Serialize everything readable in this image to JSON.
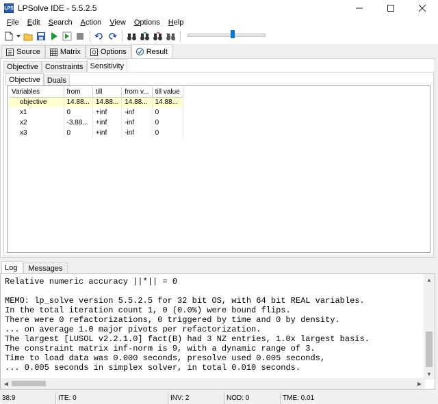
{
  "window": {
    "title": "LPSolve IDE - 5.5.2.5",
    "icon_text": "LPS"
  },
  "menu": [
    "File",
    "Edit",
    "Search",
    "Action",
    "View",
    "Options",
    "Help"
  ],
  "toolbar": {
    "slider_value": 0.58,
    "accent": "#0078d7"
  },
  "main_tabs": [
    {
      "label": "Source",
      "icon": "source-icon"
    },
    {
      "label": "Matrix",
      "icon": "matrix-icon"
    },
    {
      "label": "Options",
      "icon": "options-icon"
    },
    {
      "label": "Result",
      "icon": "result-icon",
      "active": true
    }
  ],
  "result_tabs": [
    "Objective",
    "Constraints",
    "Sensitivity"
  ],
  "sensitivity_tabs": [
    "Objective",
    "Duals"
  ],
  "grid": {
    "headers": [
      "Variables",
      "from",
      "till",
      "from v...",
      "till value"
    ],
    "rows": [
      [
        "objective",
        "14.88...",
        "14.88...",
        "14.88...",
        "14.88..."
      ],
      [
        "x1",
        "0",
        "+inf",
        "-inf",
        "0"
      ],
      [
        "x2",
        "-3.88...",
        "+inf",
        "-inf",
        "0"
      ],
      [
        "x3",
        "0",
        "+inf",
        "-inf",
        "0"
      ]
    ]
  },
  "log_tabs": [
    "Log",
    "Messages"
  ],
  "log_lines": [
    "Relative numeric accuracy ||*|| = 0",
    "",
    "MEMO: lp_solve version 5.5.2.5 for 32 bit OS, with 64 bit REAL variables.",
    "In the total iteration count 1, 0 (0.0%) were bound flips.",
    "There were 0 refactorizations, 0 triggered by time and 0 by density.",
    "... on average 1.0 major pivots per refactorization.",
    "The largest [LUSOL v2.2.1.0] fact(B) had 3 NZ entries, 1.0x largest basis.",
    "The constraint matrix inf-norm is 9, with a dynamic range of 3.",
    "Time to load data was 0.000 seconds, presolve used 0.005 seconds,",
    "... 0.005 seconds in simplex solver, in total 0.010 seconds."
  ],
  "status": {
    "position": "38:9",
    "ite": "ITE: 0",
    "inv": "INV: 2",
    "nod": "NOD: 0",
    "tme": "TME: 0.01"
  }
}
